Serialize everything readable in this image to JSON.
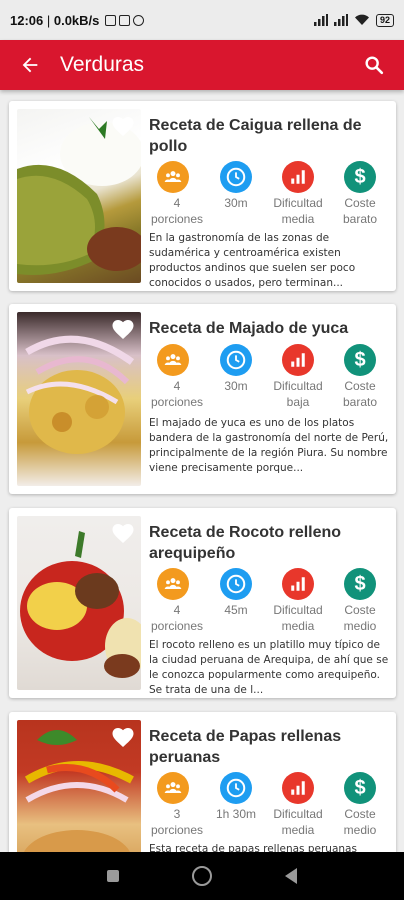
{
  "status_bar": {
    "time": "12:06",
    "speed": "0.0kB/s",
    "battery": "92"
  },
  "app_bar": {
    "title": "Verduras",
    "back_icon": "arrow-back-icon",
    "search_icon": "search-icon"
  },
  "recipes": [
    {
      "title": "Receta de Caigua rellena de pollo",
      "portions": "4",
      "portions_label": "porciones",
      "time": "30m",
      "difficulty_label": "Dificultad",
      "difficulty": "media",
      "cost_label": "Coste",
      "cost": "barato",
      "description": "En la gastronomía de las zonas de sudamérica y centroamérica existen productos andinos que suelen ser poco conocidos o usados, pero terminan..."
    },
    {
      "title": "Receta de Majado de yuca",
      "portions": "4",
      "portions_label": "porciones",
      "time": "30m",
      "difficulty_label": "Dificultad",
      "difficulty": "baja",
      "cost_label": "Coste",
      "cost": "barato",
      "description": "El majado de yuca es uno de los platos bandera de la gastronomía del norte de Perú, principalmente de la región Piura. Su nombre viene precisamente porque..."
    },
    {
      "title": "Receta de Rocoto relleno arequipeño",
      "portions": "4",
      "portions_label": "porciones",
      "time": "45m",
      "difficulty_label": "Dificultad",
      "difficulty": "media",
      "cost_label": "Coste",
      "cost": "medio",
      "description": "El rocoto relleno es un platillo muy típico de la ciudad peruana de Arequipa, de ahí que se le conozca popularmente como arequipeño. Se trata de una de l..."
    },
    {
      "title": "Receta de Papas rellenas peruanas",
      "portions": "3",
      "portions_label": "porciones",
      "time": "1h 30m",
      "difficulty_label": "Dificultad",
      "difficulty": "media",
      "cost_label": "Coste",
      "cost": "medio",
      "description": "Esta receta de papas rellenas peruanas"
    }
  ],
  "colors": {
    "accent": "#d9162e",
    "portions": "#f39a1e",
    "time": "#1e9df1",
    "difficulty": "#e8372b",
    "cost": "#11927a"
  },
  "icons": [
    "group-icon",
    "clock-icon",
    "bar-chart-icon",
    "dollar-icon",
    "heart-icon"
  ]
}
